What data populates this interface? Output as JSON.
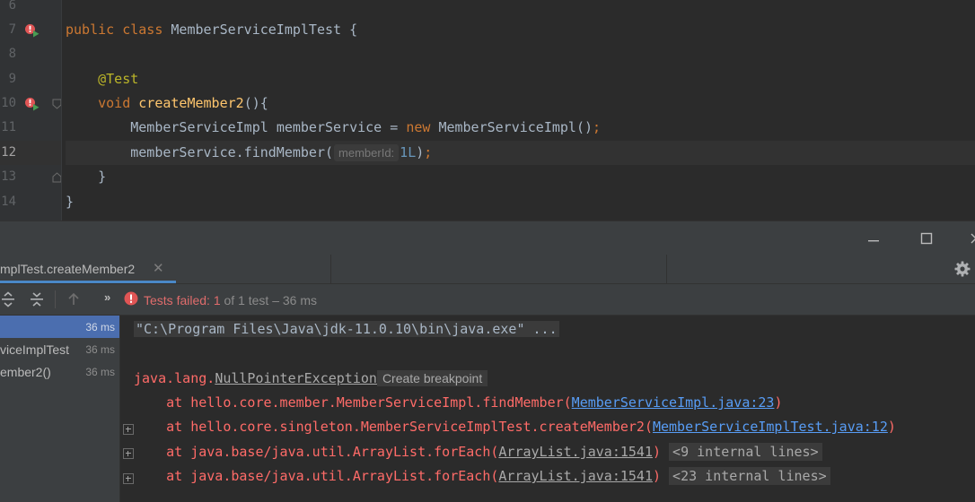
{
  "editor": {
    "line_numbers": [
      "6",
      "7",
      "8",
      "9",
      "10",
      "11",
      "12",
      "13",
      "14"
    ],
    "lines": {
      "l7": {
        "kw1": "public",
        "kw2": "class",
        "name": "MemberServiceImplTest",
        "brace": "{"
      },
      "l9": {
        "annotation": "@Test"
      },
      "l10": {
        "kw": "void",
        "method": "createMember2",
        "rest": "(){"
      },
      "l11": {
        "type": "MemberServiceImpl",
        "var": "memberService",
        "eq": "=",
        "kw": "new",
        "ctor": "MemberServiceImpl()",
        "semi": ";"
      },
      "l12": {
        "call": "memberService.findMember(",
        "hint": "memberId:",
        "arg": "1L",
        "close": ")",
        "semi": ";"
      },
      "l13": {
        "brace": "}"
      },
      "l14": {
        "brace": "}"
      }
    },
    "icons": [
      "run-test-failed-icon",
      "fold-marker-icon"
    ]
  },
  "toolwindow": {
    "window_buttons": [
      "minimize-icon",
      "maximize-icon",
      "close-icon"
    ],
    "tab": {
      "label": "mplTest.createMember2",
      "close": "✕"
    },
    "toolbar": {
      "chevron": "»",
      "status_failed": "Tests failed:",
      "status_count": " 1 ",
      "status_rest": "of 1 test – 36 ms"
    },
    "tree": [
      {
        "name": "",
        "time": "36 ms",
        "selected": true
      },
      {
        "name": "viceImplTest",
        "time": "36 ms",
        "selected": false
      },
      {
        "name": "ember2()",
        "time": "36 ms",
        "selected": false
      }
    ],
    "console": {
      "cmd": "\"C:\\Program Files\\Java\\jdk-11.0.10\\bin\\java.exe\" ...",
      "exception_pkg": "java.lang.",
      "exception_name": "NullPointerException",
      "create_breakpoint": "Create breakpoint",
      "frames": [
        {
          "prefix": "    at hello.core.member.MemberServiceImpl.findMember(",
          "link": "MemberServiceImpl.java:23",
          "suffix": ")",
          "badge": ""
        },
        {
          "prefix": "    at hello.core.singleton.MemberServiceImplTest.createMember2(",
          "link": "MemberServiceImplTest.java:12",
          "suffix": ")",
          "badge": ""
        },
        {
          "prefix": "    at java.base/java.util.ArrayList.forEach(",
          "link": "ArrayList.java:1541",
          "suffix": ")",
          "badge": "<9 internal lines>"
        },
        {
          "prefix": "    at java.base/java.util.ArrayList.forEach(",
          "link": "ArrayList.java:1541",
          "suffix": ")",
          "badge": "<23 internal lines>"
        }
      ]
    },
    "colors": {
      "accent": "#4a88c7",
      "error": "#ff6b68",
      "selection": "#4b6eaf"
    }
  }
}
